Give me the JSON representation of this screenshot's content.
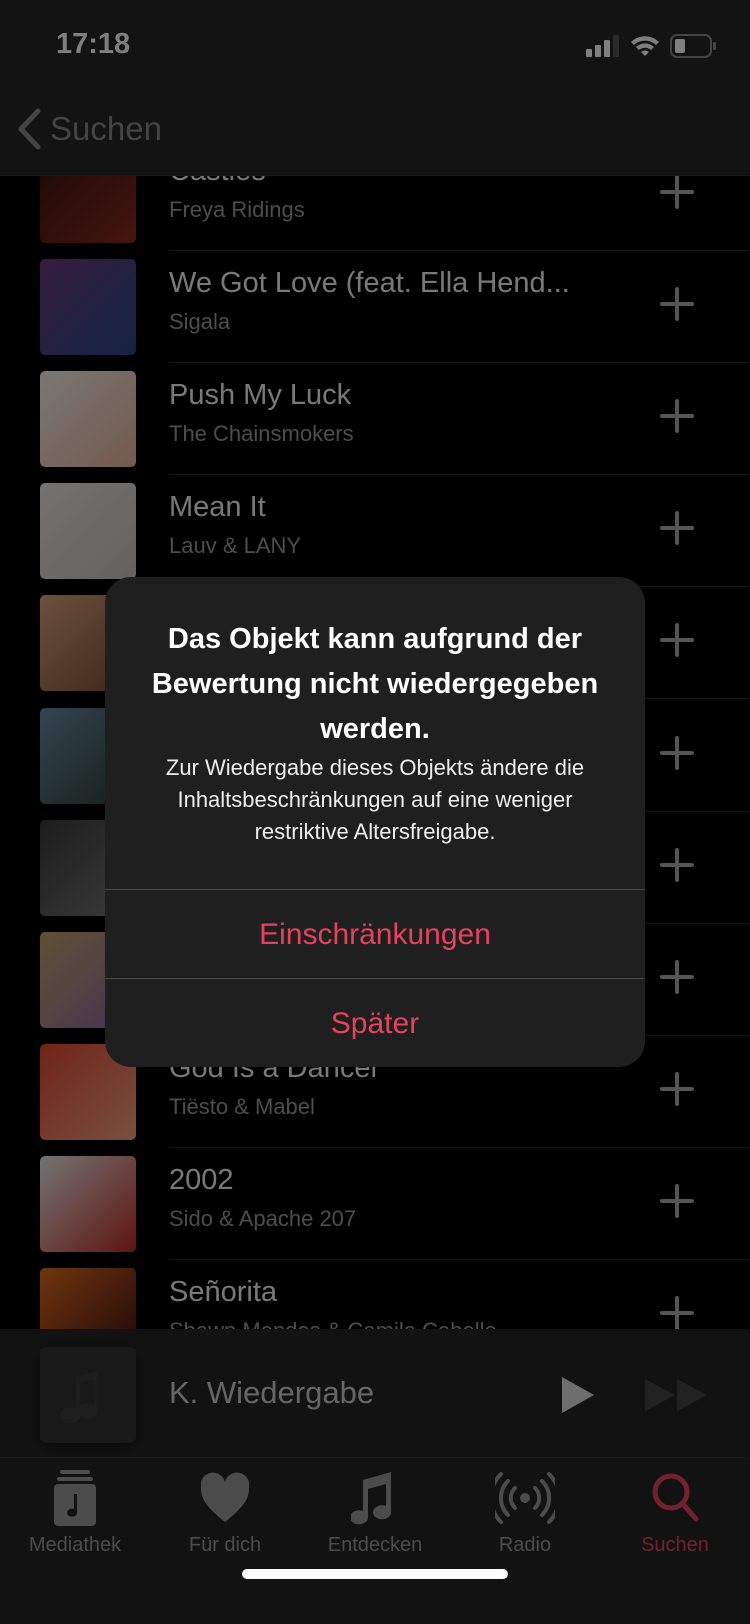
{
  "status_bar": {
    "time": "17:18",
    "icons": [
      "cellular-signal-icon",
      "wifi-icon",
      "battery-icon"
    ]
  },
  "nav": {
    "back_label": "Suchen"
  },
  "songs": [
    {
      "title": "Castles",
      "artist": "Freya Ridings",
      "art": [
        "#3a1210",
        "#8a2a1c"
      ]
    },
    {
      "title": "We Got Love (feat. Ella Hend...",
      "artist": "Sigala",
      "art": [
        "#6a3a7a",
        "#2a4a8a"
      ]
    },
    {
      "title": "Push My Luck",
      "artist": "The Chainsmokers",
      "art": [
        "#f2efea",
        "#e8b49a"
      ]
    },
    {
      "title": "Mean It",
      "artist": "Lauv & LANY",
      "art": [
        "#e8e6e2",
        "#c8c4c0"
      ]
    },
    {
      "title": "",
      "artist": "",
      "art": [
        "#d9a27a",
        "#7a4a30"
      ]
    },
    {
      "title": "",
      "artist": "",
      "art": [
        "#6a8aa0",
        "#2a3a30"
      ]
    },
    {
      "title": "",
      "artist": "",
      "art": [
        "#3a3a3a",
        "#777777"
      ]
    },
    {
      "title": "",
      "artist": "",
      "art": [
        "#c0a070",
        "#8a6aa0"
      ]
    },
    {
      "title": "God Is a Dancer",
      "artist": "Tiësto & Mabel",
      "art": [
        "#e04a30",
        "#f0a080"
      ]
    },
    {
      "title": "2002",
      "artist": "Sido & Apache 207",
      "art": [
        "#e8e8e8",
        "#c02a20"
      ]
    },
    {
      "title": "Señorita",
      "artist": "Shawn Mendes & Camila Cabello",
      "art": [
        "#e06a20",
        "#3a0a10"
      ]
    }
  ],
  "mini_player": {
    "title": "K. Wiedergabe"
  },
  "tabs": [
    {
      "label": "Mediathek",
      "icon": "library-icon"
    },
    {
      "label": "Für dich",
      "icon": "heart-icon"
    },
    {
      "label": "Entdecken",
      "icon": "music-note-icon"
    },
    {
      "label": "Radio",
      "icon": "radio-icon"
    },
    {
      "label": "Suchen",
      "icon": "search-icon",
      "active": true
    }
  ],
  "alert": {
    "title": "Das Objekt kann aufgrund der Bewertung nicht wiedergegeben werden.",
    "message": "Zur Wiedergabe dieses Objekts ändere die Inhaltsbeschränkungen auf eine weniger restriktive Altersfreigabe.",
    "primary_button": "Einschränkungen",
    "secondary_button": "Später"
  },
  "colors": {
    "accent": "#e5425f",
    "alert_bg": "#1f1f1f"
  }
}
